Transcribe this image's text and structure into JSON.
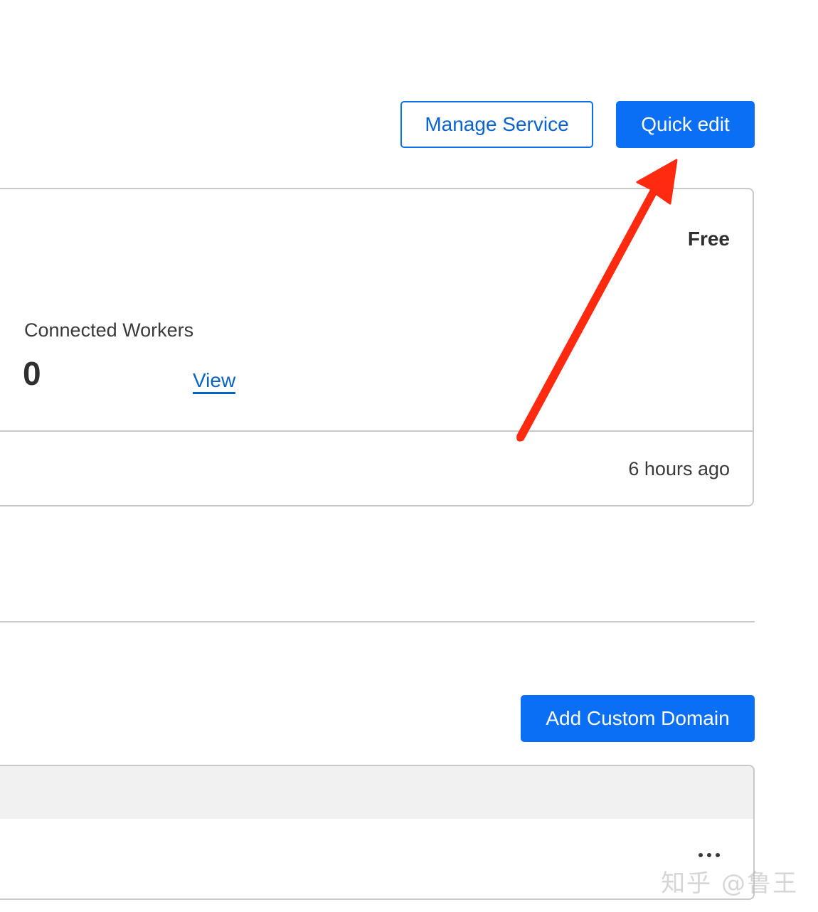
{
  "header": {
    "manage_service_label": "Manage Service",
    "quick_edit_label": "Quick edit"
  },
  "worker_card": {
    "plan": "Free",
    "connected_workers_label": "Connected Workers",
    "connected_workers_value": "0",
    "view_link": "View",
    "updated": "6 hours ago"
  },
  "domains": {
    "add_button_label": "Add Custom Domain",
    "row_menu_icon": "more-dots-icon"
  },
  "annotation": {
    "arrow_color": "#ff2a10"
  },
  "watermark": "知乎 @鲁王",
  "colors": {
    "accent": "#0a6ff4",
    "link": "#0a63c4",
    "border": "#c9c9c9"
  }
}
